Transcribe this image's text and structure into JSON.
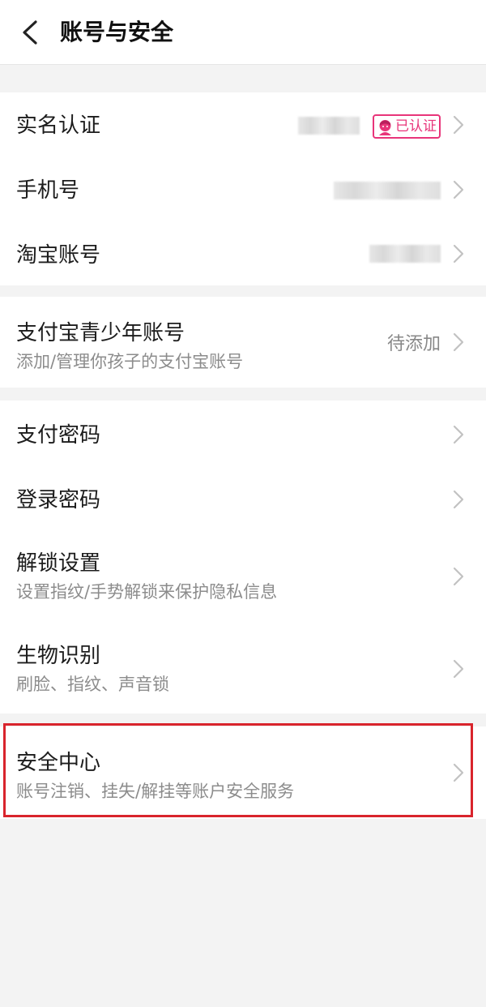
{
  "header": {
    "title": "账号与安全"
  },
  "group1": {
    "real_name": {
      "title": "实名认证",
      "badge": "已认证"
    },
    "phone": {
      "title": "手机号"
    },
    "taobao": {
      "title": "淘宝账号"
    }
  },
  "group2": {
    "teen_account": {
      "title": "支付宝青少年账号",
      "subtitle": "添加/管理你孩子的支付宝账号",
      "value": "待添加"
    }
  },
  "group3": {
    "pay_password": {
      "title": "支付密码"
    },
    "login_password": {
      "title": "登录密码"
    },
    "unlock": {
      "title": "解锁设置",
      "subtitle": "设置指纹/手势解锁来保护隐私信息"
    },
    "biometric": {
      "title": "生物识别",
      "subtitle": "刷脸、指纹、声音锁"
    }
  },
  "group4": {
    "security_center": {
      "title": "安全中心",
      "subtitle": "账号注销、挂失/解挂等账户安全服务"
    }
  },
  "colors": {
    "badge_accent": "#e8357a",
    "highlight": "#d9242c",
    "background": "#f3f3f3"
  }
}
